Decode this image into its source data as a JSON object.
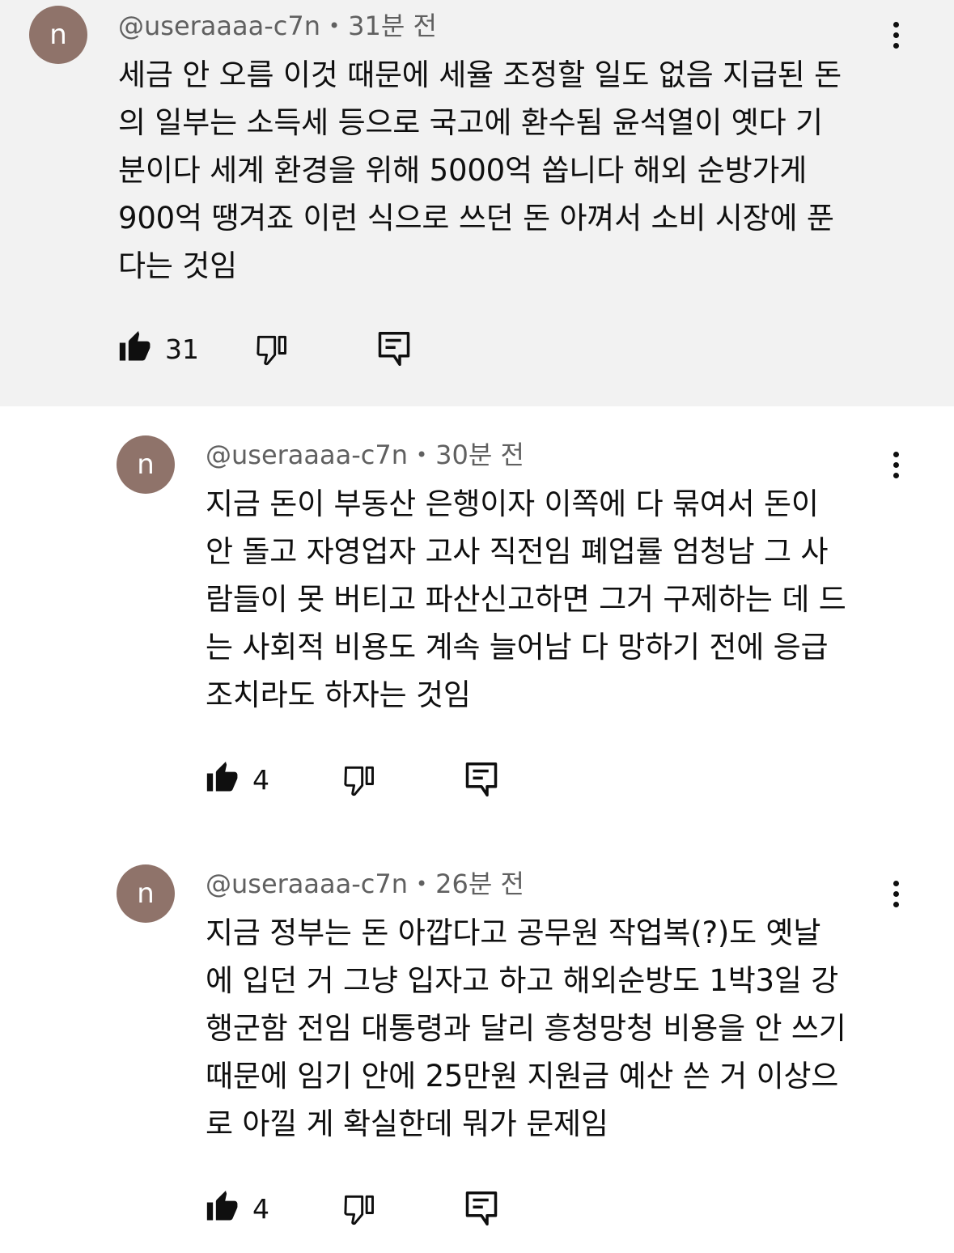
{
  "comments": [
    {
      "avatar_letter": "n",
      "author": "@useraaaa-c7n",
      "separator": "•",
      "time": "31분 전",
      "lines": [
        "세금 안 오름 이것 때문에 세율 조정할 일도 없음 지급된 돈",
        "의 일부는 소득세 등으로 국고에 환수됨 윤석열이 옛다 기",
        "분이다 세계 환경을 위해 5000억 쏩니다 해외 순방가게",
        "900억 땡겨죠 이런 식으로 쓰던 돈 아껴서 소비 시장에 푼",
        "다는 것임"
      ],
      "likes": "31",
      "icons": {
        "like": "thumbs-up-icon",
        "dislike": "thumbs-down-icon",
        "reply": "reply-icon",
        "more": "more-vert-icon"
      }
    },
    {
      "avatar_letter": "n",
      "author": "@useraaaa-c7n",
      "separator": "•",
      "time": "30분 전",
      "lines": [
        "지금 돈이 부동산 은행이자 이쪽에 다 묶여서 돈이",
        "안 돌고 자영업자 고사 직전임 폐업률 엄청남 그 사",
        "람들이 못 버티고 파산신고하면 그거 구제하는 데 드",
        "는 사회적 비용도 계속 늘어남 다 망하기 전에 응급",
        "조치라도 하자는 것임"
      ],
      "likes": "4",
      "icons": {
        "like": "thumbs-up-icon",
        "dislike": "thumbs-down-icon",
        "reply": "reply-icon",
        "more": "more-vert-icon"
      }
    },
    {
      "avatar_letter": "n",
      "author": "@useraaaa-c7n",
      "separator": "•",
      "time": "26분 전",
      "lines": [
        "지금 정부는 돈 아깝다고 공무원 작업복(?)도 옛날",
        "에 입던 거 그냥 입자고 하고 해외순방도 1박3일 강",
        "행군함 전임 대통령과 달리 흥청망청 비용을 안 쓰기",
        "때문에 임기 안에 25만원 지원금 예산 쓴 거 이상으",
        "로 아낄 게 확실한데 뭐가 문제임"
      ],
      "likes": "4",
      "icons": {
        "like": "thumbs-up-icon",
        "dislike": "thumbs-down-icon",
        "reply": "reply-icon",
        "more": "more-vert-icon"
      }
    }
  ],
  "colors": {
    "avatar_bg": "#8f736a",
    "highlight_bg": "#f2f2f2",
    "meta_text": "#606060",
    "text": "#0f0f0f"
  }
}
